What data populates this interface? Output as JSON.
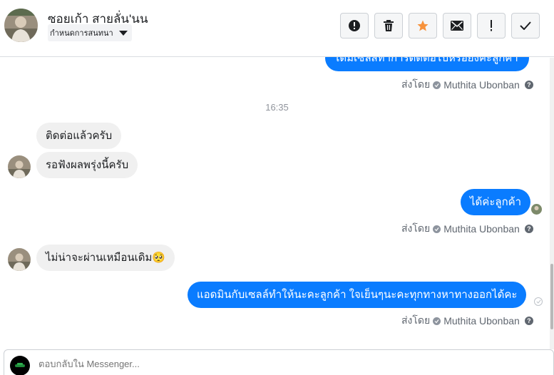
{
  "header": {
    "contact_name": "ซอยเก้า สายลั่น'นน",
    "label_select": "กำหนดการสนทนา",
    "actions": [
      {
        "name": "report-button",
        "icon": "alert-circle-icon"
      },
      {
        "name": "delete-button",
        "icon": "trash-icon"
      },
      {
        "name": "star-button",
        "icon": "star-icon",
        "color": "#f7923b"
      },
      {
        "name": "mark-unread-button",
        "icon": "envelope-icon"
      },
      {
        "name": "spam-button",
        "icon": "exclamation-icon"
      },
      {
        "name": "mark-done-button",
        "icon": "check-icon"
      }
    ]
  },
  "messages": {
    "top_cut_text": "เดิมเซลส์ทำการติดต่อไปหรือยังคะลูกค้า",
    "sender_prefix": "ส่งโดย",
    "sender_name": "Muthita Ubonban",
    "timestamp": "16:35",
    "in_1": "ติดต่อแล้วครับ",
    "in_2": "รอฟังผลพรุ่งนี้ครับ",
    "out_1": "ได้ค่ะลูกค้า",
    "in_3": "ไม่น่าจะผ่านเหมือนเดิม",
    "in_3_emoji": "🥺",
    "out_2": "แอดมินกับเซลล์ทำให้นะคะลูกค้า ใจเย็นๆนะคะทุกทางหาทางออกได้คะ"
  },
  "composer": {
    "placeholder": "ตอบกลับใน Messenger..."
  },
  "colors": {
    "accent": "#0a7cff",
    "incoming_bubble": "#f0f0f0",
    "star": "#f7923b"
  }
}
